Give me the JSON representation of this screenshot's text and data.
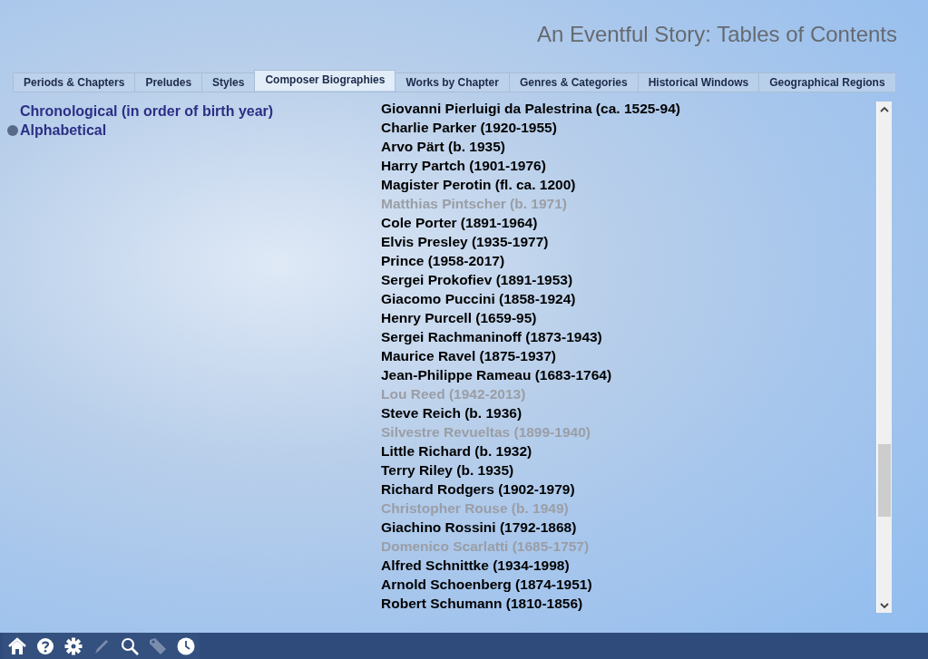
{
  "window": {
    "title": "An Eventful Story: Tables of Contents"
  },
  "tabs": [
    {
      "label": "Periods & Chapters",
      "selected": false
    },
    {
      "label": "Preludes",
      "selected": false
    },
    {
      "label": "Styles",
      "selected": false
    },
    {
      "label": "Composer Biographies",
      "selected": true
    },
    {
      "label": "Works by Chapter",
      "selected": false
    },
    {
      "label": "Genres & Categories",
      "selected": false
    },
    {
      "label": "Historical Windows",
      "selected": false
    },
    {
      "label": "Geographical Regions",
      "selected": false
    }
  ],
  "sort_options": [
    {
      "label": "Chronological (in order of birth year)",
      "selected": false
    },
    {
      "label": "Alphabetical",
      "selected": true
    }
  ],
  "composers": [
    {
      "name": "Giovanni Pierluigi da Palestrina (ca. 1525-94)",
      "disabled": false
    },
    {
      "name": "Charlie Parker (1920-1955)",
      "disabled": false
    },
    {
      "name": "Arvo Pärt (b. 1935)",
      "disabled": false
    },
    {
      "name": "Harry Partch (1901-1976)",
      "disabled": false
    },
    {
      "name": "Magister Perotin (fl. ca. 1200)",
      "disabled": false
    },
    {
      "name": "Matthias Pintscher (b. 1971)",
      "disabled": true
    },
    {
      "name": "Cole Porter (1891-1964)",
      "disabled": false
    },
    {
      "name": "Elvis Presley (1935-1977)",
      "disabled": false
    },
    {
      "name": "Prince (1958-2017)",
      "disabled": false
    },
    {
      "name": "Sergei Prokofiev (1891-1953)",
      "disabled": false
    },
    {
      "name": "Giacomo Puccini (1858-1924)",
      "disabled": false
    },
    {
      "name": "Henry Purcell (1659-95)",
      "disabled": false
    },
    {
      "name": "Sergei Rachmaninoff (1873-1943)",
      "disabled": false
    },
    {
      "name": "Maurice Ravel (1875-1937)",
      "disabled": false
    },
    {
      "name": "Jean-Philippe Rameau (1683-1764)",
      "disabled": false
    },
    {
      "name": "Lou Reed (1942-2013)",
      "disabled": true
    },
    {
      "name": "Steve Reich (b. 1936)",
      "disabled": false
    },
    {
      "name": "Silvestre Revueltas (1899-1940)",
      "disabled": true
    },
    {
      "name": "Little Richard (b. 1932)",
      "disabled": false
    },
    {
      "name": "Terry Riley (b. 1935)",
      "disabled": false
    },
    {
      "name": "Richard Rodgers (1902-1979)",
      "disabled": false
    },
    {
      "name": "Christopher Rouse (b. 1949)",
      "disabled": true
    },
    {
      "name": "Giachino Rossini (1792-1868)",
      "disabled": false
    },
    {
      "name": "Domenico Scarlatti (1685-1757)",
      "disabled": true
    },
    {
      "name": "Alfred Schnittke (1934-1998)",
      "disabled": false
    },
    {
      "name": "Arnold Schoenberg (1874-1951)",
      "disabled": false
    },
    {
      "name": "Robert Schumann (1810-1856)",
      "disabled": false
    }
  ],
  "toolbar": [
    {
      "kind": "home",
      "disabled": false
    },
    {
      "kind": "help",
      "disabled": false
    },
    {
      "kind": "settings",
      "disabled": false
    },
    {
      "kind": "pencil",
      "disabled": true
    },
    {
      "kind": "search",
      "disabled": false
    },
    {
      "kind": "tag",
      "disabled": true
    },
    {
      "kind": "clock",
      "disabled": false
    }
  ]
}
